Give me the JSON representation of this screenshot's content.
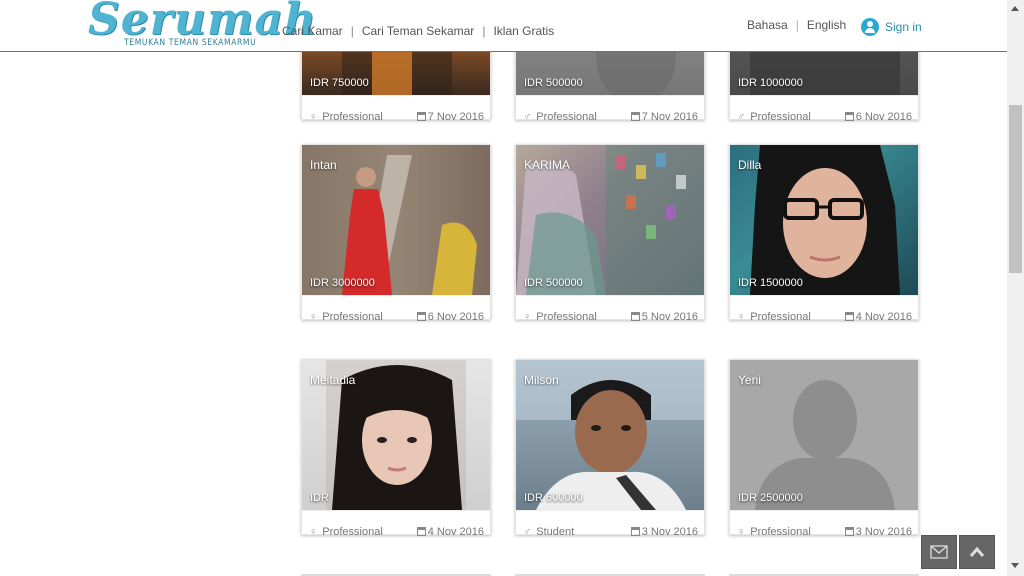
{
  "header": {
    "logo_text": "Serumah",
    "logo_tagline": "TEMUKAN TEMAN SEKAMARMU",
    "nav": [
      {
        "label": "Cari Kamar"
      },
      {
        "label": "Cari Teman Sekamar"
      },
      {
        "label": "Iklan Gratis"
      }
    ],
    "language_label": "Bahasa",
    "language_value": "English",
    "signin_label": "Sign in"
  },
  "listings": [
    {
      "name": "",
      "price": "IDR 750000",
      "gender": "female",
      "occupation": "Professional",
      "date": "7 Nov 2016"
    },
    {
      "name": "",
      "price": "IDR 500000",
      "gender": "male",
      "occupation": "Professional",
      "date": "7 Nov 2016"
    },
    {
      "name": "",
      "price": "IDR 1000000",
      "gender": "male",
      "occupation": "Professional",
      "date": "6 Nov 2016"
    },
    {
      "name": "Intan",
      "price": "IDR 3000000",
      "gender": "female",
      "occupation": "Professional",
      "date": "6 Nov 2016"
    },
    {
      "name": "KARIMA",
      "price": "IDR 500000",
      "gender": "female",
      "occupation": "Professional",
      "date": "5 Nov 2016"
    },
    {
      "name": "Dilla",
      "price": "IDR 1500000",
      "gender": "female",
      "occupation": "Professional",
      "date": "4 Nov 2016"
    },
    {
      "name": "Meitadia",
      "price": "IDR",
      "gender": "female",
      "occupation": "Professional",
      "date": "4 Nov 2016"
    },
    {
      "name": "Milson",
      "price": "IDR 600000",
      "gender": "male",
      "occupation": "Student",
      "date": "3 Nov 2016"
    },
    {
      "name": "Yeni",
      "price": "IDR 2500000",
      "gender": "female",
      "occupation": "Professional",
      "date": "3 Nov 2016"
    }
  ],
  "icons": {
    "female": "female-icon",
    "male": "male-icon",
    "calendar": "calendar-icon",
    "mail": "mail-icon",
    "scroll_top": "chevron-up-icon"
  },
  "colors": {
    "accent": "#2b8ba8",
    "logo": "#4fb3d1",
    "fab": "#666666"
  }
}
